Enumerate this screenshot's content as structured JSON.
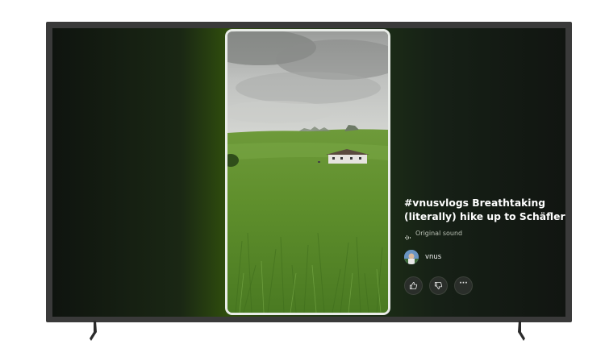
{
  "short": {
    "title": "#vnusvlogs Breathtaking (literally) hike up to Schäfler",
    "sound_label": "Original sound",
    "channel_name": "vnus"
  },
  "actions": {
    "like_icon": "thumbs-up-icon",
    "dislike_icon": "thumbs-down-icon",
    "more_label": "···"
  },
  "colors": {
    "screen_accent": "#2f4d0d",
    "video_border": "#e9ece8",
    "text_primary": "#ffffff",
    "text_secondary": "#b9c0b4"
  }
}
